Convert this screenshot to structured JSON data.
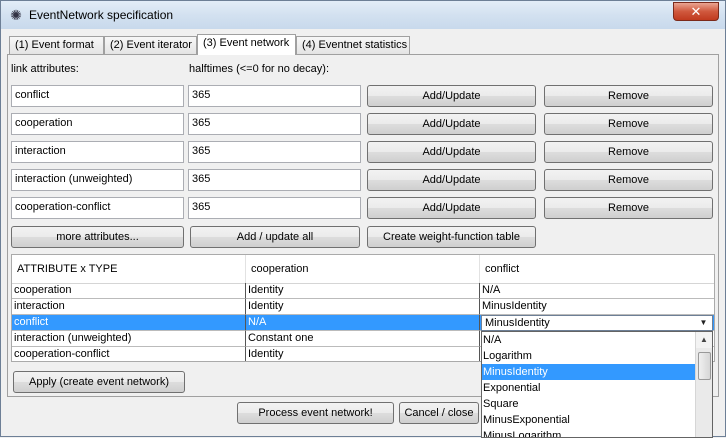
{
  "window": {
    "title": "EventNetwork specification",
    "close_label": "✕"
  },
  "tabs": [
    {
      "label": "(1) Event format"
    },
    {
      "label": "(2) Event iterator"
    },
    {
      "label": "(3) Event network"
    },
    {
      "label": "(4) Eventnet statistics"
    }
  ],
  "headers": {
    "link_attributes": "link attributes:",
    "halftimes": "halftimes (<=0 for no decay):"
  },
  "rows": [
    {
      "name": "conflict",
      "halftime": "365",
      "add_label": "Add/Update",
      "remove_label": "Remove"
    },
    {
      "name": "cooperation",
      "halftime": "365",
      "add_label": "Add/Update",
      "remove_label": "Remove"
    },
    {
      "name": "interaction",
      "halftime": "365",
      "add_label": "Add/Update",
      "remove_label": "Remove"
    },
    {
      "name": "interaction (unweighted)",
      "halftime": "365",
      "add_label": "Add/Update",
      "remove_label": "Remove"
    },
    {
      "name": "cooperation-conflict",
      "halftime": "365",
      "add_label": "Add/Update",
      "remove_label": "Remove"
    }
  ],
  "actions": {
    "more_attributes": "more attributes...",
    "add_update_all": "Add / update all",
    "weight_table": "Create weight-function table"
  },
  "table": {
    "columns": [
      "ATTRIBUTE x TYPE",
      "cooperation",
      "conflict"
    ],
    "rows": [
      [
        "cooperation",
        "Identity",
        "N/A"
      ],
      [
        "interaction",
        "Identity",
        "MinusIdentity"
      ],
      [
        "conflict",
        "N/A",
        ""
      ],
      [
        "interaction (unweighted)",
        "Constant one",
        ""
      ],
      [
        "cooperation-conflict",
        "Identity",
        ""
      ]
    ]
  },
  "combo": {
    "value": "MinusIdentity",
    "options": [
      "N/A",
      "Logarithm",
      "MinusIdentity",
      "Exponential",
      "Square",
      "MinusExponential",
      "MinusLogarithm"
    ],
    "selected": "MinusIdentity"
  },
  "buttons": {
    "apply": "Apply (create event network)",
    "process": "Process event network!",
    "cancel": "Cancel / close"
  }
}
